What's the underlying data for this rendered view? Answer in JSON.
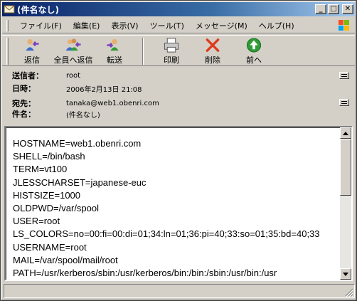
{
  "window": {
    "title": "(件名なし)",
    "caption": {
      "minimize": "_",
      "maximize": "□",
      "close": "✕"
    }
  },
  "menu": [
    {
      "label": "ファイル(F)"
    },
    {
      "label": "編集(E)"
    },
    {
      "label": "表示(V)"
    },
    {
      "label": "ツール(T)"
    },
    {
      "label": "メッセージ(M)"
    },
    {
      "label": "ヘルプ(H)"
    }
  ],
  "toolbar": {
    "reply": "返信",
    "reply_all": "全員へ返信",
    "forward": "転送",
    "print": "印刷",
    "delete": "削除",
    "next": "前へ"
  },
  "headers": {
    "from": {
      "label": "送信者：",
      "value": "root"
    },
    "date": {
      "label": "日時：",
      "value": "2006年2月13日 21:08"
    },
    "to": {
      "label": "宛先：",
      "value": "tanaka@web1.obenri.com"
    },
    "subject": {
      "label": "件名：",
      "value": "(件名なし)"
    }
  },
  "body_lines": [
    "HOSTNAME=web1.obenri.com",
    "SHELL=/bin/bash",
    "TERM=vt100",
    "JLESSCHARSET=japanese-euc",
    "HISTSIZE=1000",
    "OLDPWD=/var/spool",
    "USER=root",
    "LS_COLORS=no=00:fi=00:di=01;34:ln=01;36:pi=40;33:so=01;35:bd=40;33",
    "USERNAME=root",
    "MAIL=/var/spool/mail/root",
    "PATH=/usr/kerberos/sbin:/usr/kerberos/bin:/bin:/sbin:/usr/bin:/usr"
  ],
  "colors": {
    "reply_accent": "#7b3fb5",
    "delete_accent": "#e03a1c",
    "next_accent": "#2e9a35"
  }
}
